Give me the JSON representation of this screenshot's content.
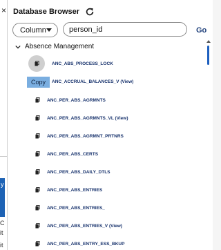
{
  "panel": {
    "title": "Database Browser",
    "column_select": {
      "value": "Column"
    },
    "search": {
      "value": "person_id"
    },
    "go_label": "Go"
  },
  "tree": {
    "group_label": "Absence Management",
    "tooltip": "Copy",
    "items": [
      "ANC_ABS_PROCESS_LOCK",
      "ANC_ACCRUAL_BALANCES_V (View)",
      "ANC_PER_ABS_AGRMNTS",
      "ANC_PER_ABS_AGRMNTS_VL (View)",
      "ANC_PER_ABS_AGRMNT_PRTNRS",
      "ANC_PER_ABS_CERTS",
      "ANC_PER_ABS_DAILY_DTLS",
      "ANC_PER_ABS_ENTRIES",
      "ANC_PER_ABS_ENTRIES_",
      "ANC_PER_ABS_ENTRIES_V (View)",
      "ANC_PER_ABS_ENTRY_ESS_BKUP"
    ]
  },
  "background": {
    "close_glyph": "×",
    "fragments": [
      "y",
      "C",
      "it",
      "it"
    ]
  },
  "colors": {
    "accent": "#1d5fbf",
    "item_text": "#15306b",
    "tooltip_bg": "#7aaee0"
  },
  "icons": {
    "refresh": "refresh-icon",
    "copy": "copy-icon",
    "chevron": "chevron-down-icon"
  }
}
